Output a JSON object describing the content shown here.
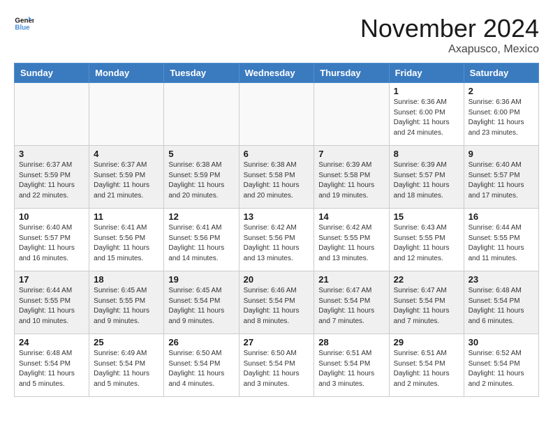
{
  "header": {
    "logo_line1": "General",
    "logo_line2": "Blue",
    "month": "November 2024",
    "location": "Axapusco, Mexico"
  },
  "weekdays": [
    "Sunday",
    "Monday",
    "Tuesday",
    "Wednesday",
    "Thursday",
    "Friday",
    "Saturday"
  ],
  "weeks": [
    [
      {
        "day": "",
        "info": ""
      },
      {
        "day": "",
        "info": ""
      },
      {
        "day": "",
        "info": ""
      },
      {
        "day": "",
        "info": ""
      },
      {
        "day": "",
        "info": ""
      },
      {
        "day": "1",
        "info": "Sunrise: 6:36 AM\nSunset: 6:00 PM\nDaylight: 11 hours and 24 minutes."
      },
      {
        "day": "2",
        "info": "Sunrise: 6:36 AM\nSunset: 6:00 PM\nDaylight: 11 hours and 23 minutes."
      }
    ],
    [
      {
        "day": "3",
        "info": "Sunrise: 6:37 AM\nSunset: 5:59 PM\nDaylight: 11 hours and 22 minutes."
      },
      {
        "day": "4",
        "info": "Sunrise: 6:37 AM\nSunset: 5:59 PM\nDaylight: 11 hours and 21 minutes."
      },
      {
        "day": "5",
        "info": "Sunrise: 6:38 AM\nSunset: 5:59 PM\nDaylight: 11 hours and 20 minutes."
      },
      {
        "day": "6",
        "info": "Sunrise: 6:38 AM\nSunset: 5:58 PM\nDaylight: 11 hours and 20 minutes."
      },
      {
        "day": "7",
        "info": "Sunrise: 6:39 AM\nSunset: 5:58 PM\nDaylight: 11 hours and 19 minutes."
      },
      {
        "day": "8",
        "info": "Sunrise: 6:39 AM\nSunset: 5:57 PM\nDaylight: 11 hours and 18 minutes."
      },
      {
        "day": "9",
        "info": "Sunrise: 6:40 AM\nSunset: 5:57 PM\nDaylight: 11 hours and 17 minutes."
      }
    ],
    [
      {
        "day": "10",
        "info": "Sunrise: 6:40 AM\nSunset: 5:57 PM\nDaylight: 11 hours and 16 minutes."
      },
      {
        "day": "11",
        "info": "Sunrise: 6:41 AM\nSunset: 5:56 PM\nDaylight: 11 hours and 15 minutes."
      },
      {
        "day": "12",
        "info": "Sunrise: 6:41 AM\nSunset: 5:56 PM\nDaylight: 11 hours and 14 minutes."
      },
      {
        "day": "13",
        "info": "Sunrise: 6:42 AM\nSunset: 5:56 PM\nDaylight: 11 hours and 13 minutes."
      },
      {
        "day": "14",
        "info": "Sunrise: 6:42 AM\nSunset: 5:55 PM\nDaylight: 11 hours and 13 minutes."
      },
      {
        "day": "15",
        "info": "Sunrise: 6:43 AM\nSunset: 5:55 PM\nDaylight: 11 hours and 12 minutes."
      },
      {
        "day": "16",
        "info": "Sunrise: 6:44 AM\nSunset: 5:55 PM\nDaylight: 11 hours and 11 minutes."
      }
    ],
    [
      {
        "day": "17",
        "info": "Sunrise: 6:44 AM\nSunset: 5:55 PM\nDaylight: 11 hours and 10 minutes."
      },
      {
        "day": "18",
        "info": "Sunrise: 6:45 AM\nSunset: 5:55 PM\nDaylight: 11 hours and 9 minutes."
      },
      {
        "day": "19",
        "info": "Sunrise: 6:45 AM\nSunset: 5:54 PM\nDaylight: 11 hours and 9 minutes."
      },
      {
        "day": "20",
        "info": "Sunrise: 6:46 AM\nSunset: 5:54 PM\nDaylight: 11 hours and 8 minutes."
      },
      {
        "day": "21",
        "info": "Sunrise: 6:47 AM\nSunset: 5:54 PM\nDaylight: 11 hours and 7 minutes."
      },
      {
        "day": "22",
        "info": "Sunrise: 6:47 AM\nSunset: 5:54 PM\nDaylight: 11 hours and 7 minutes."
      },
      {
        "day": "23",
        "info": "Sunrise: 6:48 AM\nSunset: 5:54 PM\nDaylight: 11 hours and 6 minutes."
      }
    ],
    [
      {
        "day": "24",
        "info": "Sunrise: 6:48 AM\nSunset: 5:54 PM\nDaylight: 11 hours and 5 minutes."
      },
      {
        "day": "25",
        "info": "Sunrise: 6:49 AM\nSunset: 5:54 PM\nDaylight: 11 hours and 5 minutes."
      },
      {
        "day": "26",
        "info": "Sunrise: 6:50 AM\nSunset: 5:54 PM\nDaylight: 11 hours and 4 minutes."
      },
      {
        "day": "27",
        "info": "Sunrise: 6:50 AM\nSunset: 5:54 PM\nDaylight: 11 hours and 3 minutes."
      },
      {
        "day": "28",
        "info": "Sunrise: 6:51 AM\nSunset: 5:54 PM\nDaylight: 11 hours and 3 minutes."
      },
      {
        "day": "29",
        "info": "Sunrise: 6:51 AM\nSunset: 5:54 PM\nDaylight: 11 hours and 2 minutes."
      },
      {
        "day": "30",
        "info": "Sunrise: 6:52 AM\nSunset: 5:54 PM\nDaylight: 11 hours and 2 minutes."
      }
    ]
  ]
}
